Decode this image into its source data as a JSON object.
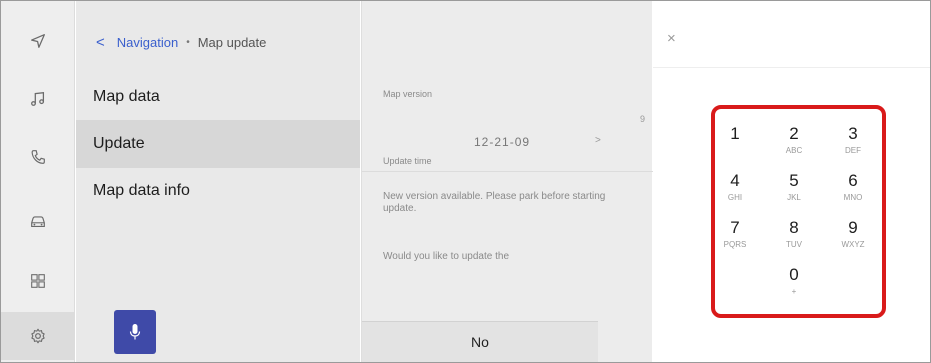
{
  "breadcrumb": {
    "back_glyph": "<",
    "parent": "Navigation",
    "separator": "•",
    "current": "Map update"
  },
  "sidebar": {
    "icons": [
      {
        "name": "navigation-icon"
      },
      {
        "name": "music-icon"
      },
      {
        "name": "phone-icon"
      },
      {
        "name": "car-icon"
      },
      {
        "name": "apps-grid-icon"
      },
      {
        "name": "settings-icon",
        "active": true
      }
    ]
  },
  "menu": {
    "items": [
      {
        "label": "Map data"
      },
      {
        "label": "Update",
        "selected": true
      },
      {
        "label": "Map data info"
      }
    ]
  },
  "content": {
    "map_version_label": "Map version",
    "map_version_value": "12-21-09",
    "chevron": ">",
    "trailing_text": "9",
    "update_time_label": "Update time",
    "notice": "New version available. Please park before starting update.",
    "question": "Would you like to update the",
    "no_button": "No"
  },
  "keypad": {
    "close": "×",
    "keys": [
      {
        "num": "1",
        "letters": ""
      },
      {
        "num": "2",
        "letters": "ABC"
      },
      {
        "num": "3",
        "letters": "DEF"
      },
      {
        "num": "4",
        "letters": "GHI"
      },
      {
        "num": "5",
        "letters": "JKL"
      },
      {
        "num": "6",
        "letters": "MNO"
      },
      {
        "num": "7",
        "letters": "PQRS"
      },
      {
        "num": "8",
        "letters": "TUV"
      },
      {
        "num": "9",
        "letters": "WXYZ"
      },
      {
        "num": "0",
        "letters": "+"
      }
    ],
    "highlight_color": "#d91a1a"
  },
  "colors": {
    "accent": "#3a5fcd",
    "mic_button": "#3f4aa8"
  }
}
